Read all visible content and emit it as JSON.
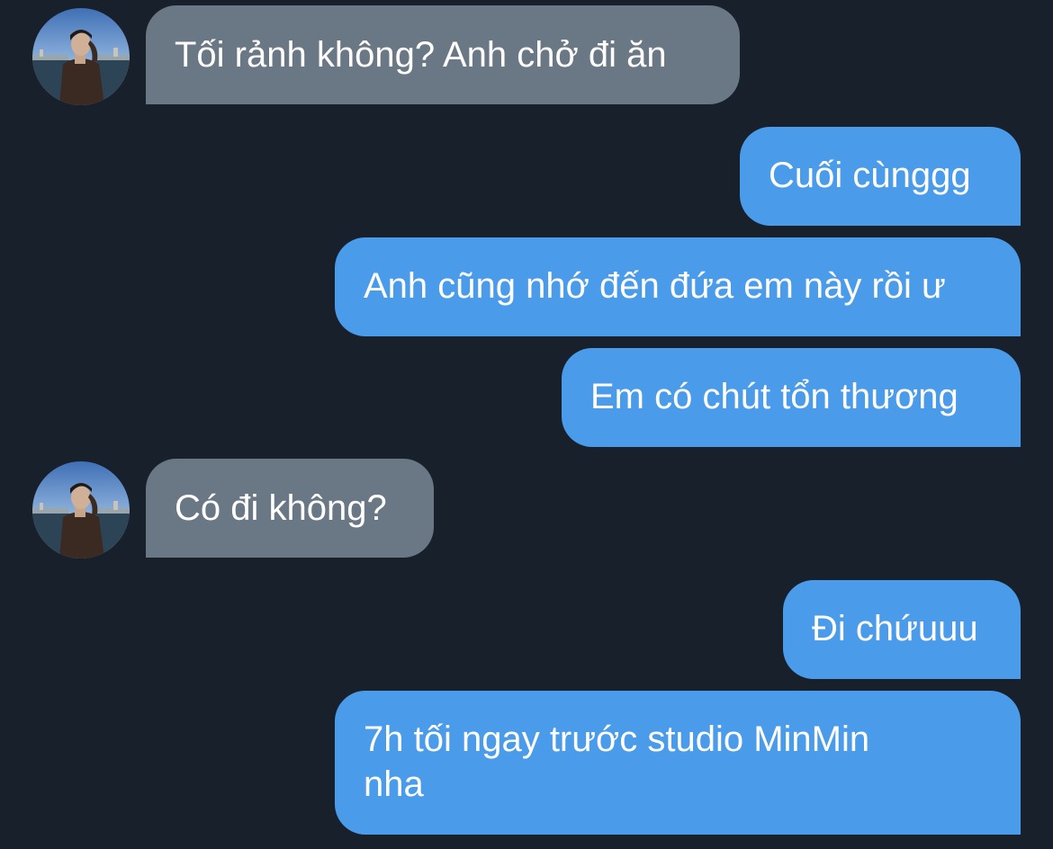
{
  "colors": {
    "background": "#18202b",
    "received_bubble": "#6a7784",
    "sent_bubble": "#4a9bea",
    "text": "#ffffff"
  },
  "contact": {
    "avatar_icon": "person-photo-avatar"
  },
  "messages": [
    {
      "direction": "received",
      "text": "Tối rảnh không? Anh chở đi ăn"
    },
    {
      "direction": "sent",
      "text": "Cuối cùnggg"
    },
    {
      "direction": "sent",
      "text": "Anh cũng nhớ đến đứa em này rồi ư"
    },
    {
      "direction": "sent",
      "text": "Em có chút tổn thương"
    },
    {
      "direction": "received",
      "text": "Có đi không?"
    },
    {
      "direction": "sent",
      "text": "Đi chứuuu"
    },
    {
      "direction": "sent",
      "text": "7h tối ngay trước studio MinMin nha"
    }
  ]
}
